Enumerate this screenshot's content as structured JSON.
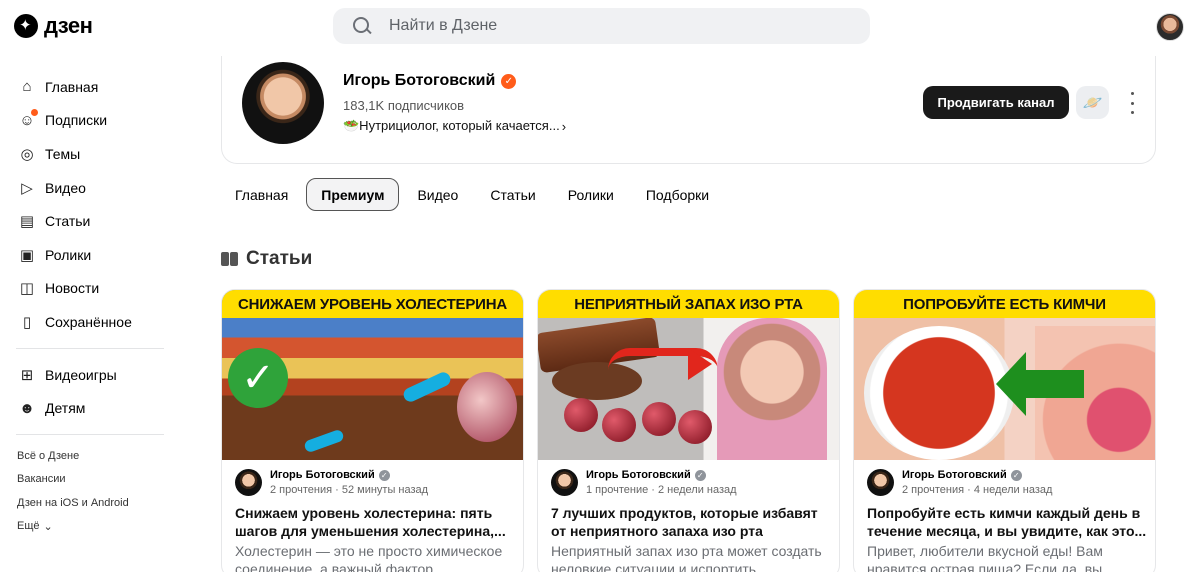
{
  "header": {
    "logo_text": "дзен",
    "search_placeholder": "Найти в Дзене"
  },
  "sidebar": {
    "items": [
      {
        "label": "Главная",
        "icon": "home-icon"
      },
      {
        "label": "Подписки",
        "icon": "subscriptions-icon",
        "dot": true
      },
      {
        "label": "Темы",
        "icon": "compass-icon"
      },
      {
        "label": "Видео",
        "icon": "video-icon"
      },
      {
        "label": "Статьи",
        "icon": "articles-icon"
      },
      {
        "label": "Ролики",
        "icon": "shorts-icon"
      },
      {
        "label": "Новости",
        "icon": "news-icon"
      },
      {
        "label": "Сохранённое",
        "icon": "bookmark-icon"
      }
    ],
    "extra_items": [
      {
        "label": "Видеоигры",
        "icon": "gamepad-icon"
      },
      {
        "label": "Детям",
        "icon": "kids-icon"
      }
    ],
    "footer_links": [
      "Всё о Дзене",
      "Вакансии",
      "Дзен на iOS и Android"
    ],
    "more_label": "Ещё"
  },
  "channel": {
    "name": "Игорь Ботоговский",
    "subscribers": "183,1K подписчиков",
    "description": "🥗Нутрициолог, который качается...",
    "promote_button": "Продвигать канал",
    "accent_color": "#ff5c1a"
  },
  "tabs": [
    {
      "label": "Главная",
      "active": false
    },
    {
      "label": "Премиум",
      "active": true
    },
    {
      "label": "Видео",
      "active": false
    },
    {
      "label": "Статьи",
      "active": false
    },
    {
      "label": "Ролики",
      "active": false
    },
    {
      "label": "Подборки",
      "active": false
    }
  ],
  "section_title": "Статьи",
  "cards": [
    {
      "banner": "СНИЖАЕМ УРОВЕНЬ ХОЛЕСТЕРИНА",
      "author": "Игорь Ботоговский",
      "stats": "2 прочтения · 52 минуты назад",
      "title": "Снижаем уровень холестерина: пять шагов для уменьшения холестерина,...",
      "snippet": "Холестерин — это не просто химическое соединение, а важный фактор,..."
    },
    {
      "banner": "НЕПРИЯТНЫЙ ЗАПАХ ИЗО РТА",
      "author": "Игорь Ботоговский",
      "stats": "1 прочтение · 2 недели назад",
      "title": "7 лучших продуктов, которые избавят от неприятного запаха изо рта",
      "snippet": "Неприятный запах изо рта может создать неловкие ситуации и испортить..."
    },
    {
      "banner": "ПОПРОБУЙТЕ ЕСТЬ КИМЧИ",
      "author": "Игорь Ботоговский",
      "stats": "2 прочтения · 4 недели назад",
      "title": "Попробуйте есть кимчи каждый день в течение месяца, и вы увидите, как это...",
      "snippet": "Привет, любители вкусной еды! Вам нравится острая пища? Если да, вы..."
    }
  ]
}
